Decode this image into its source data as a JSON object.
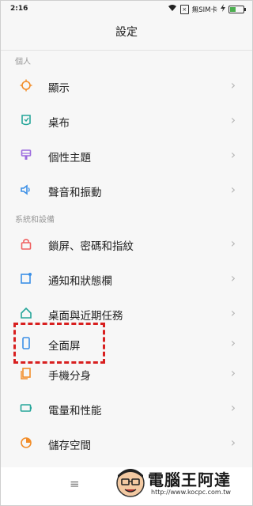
{
  "status_bar": {
    "time": "2:16",
    "sim_label": "無SIM卡",
    "icons": [
      "wifi-icon",
      "sim-x-icon",
      "charging-icon",
      "battery-icon"
    ]
  },
  "header": {
    "title": "設定"
  },
  "sections": [
    {
      "label": "個人",
      "items": [
        {
          "label": "顯示",
          "icon": "sun-icon",
          "color": "#f28c28"
        },
        {
          "label": "桌布",
          "icon": "wallpaper-icon",
          "color": "#26a69a"
        },
        {
          "label": "個性主題",
          "icon": "theme-brush-icon",
          "color": "#9c6ade"
        },
        {
          "label": "聲音和振動",
          "icon": "speaker-icon",
          "color": "#3b8fe6"
        }
      ]
    },
    {
      "label": "系統和設備",
      "items": [
        {
          "label": "鎖屏、密碼和指紋",
          "icon": "lock-icon",
          "color": "#f06060"
        },
        {
          "label": "通知和狀態欄",
          "icon": "notification-icon",
          "color": "#3b8fe6"
        },
        {
          "label": "桌面與近期任務",
          "icon": "home-icon",
          "color": "#26a69a"
        },
        {
          "label": "全面屏",
          "icon": "fullscreen-phone-icon",
          "color": "#3b8fe6"
        },
        {
          "label": "手機分身",
          "icon": "second-space-icon",
          "color": "#f28c28"
        },
        {
          "label": "電量和性能",
          "icon": "battery-performance-icon",
          "color": "#26a69a"
        },
        {
          "label": "儲存空間",
          "icon": "storage-pie-icon",
          "color": "#f28c28"
        }
      ]
    }
  ],
  "nav_bar": {
    "menu_icon": "≡",
    "back_icon": "‹"
  },
  "watermark": {
    "text": "電腦王阿達",
    "url": "http://www.kocpc.com.tw"
  },
  "colors": {
    "highlight": "#d81f1f",
    "chevron": "#b5b5b5"
  }
}
